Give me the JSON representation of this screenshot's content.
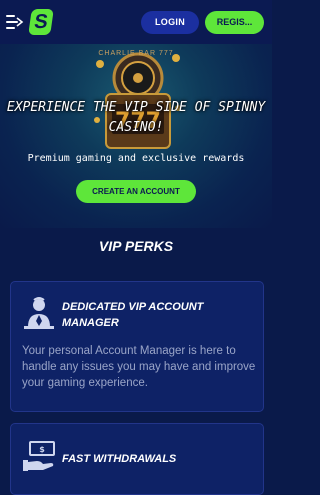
{
  "header": {
    "login_label": "LOGIN",
    "register_label": "REGIS...",
    "logo_text": "S"
  },
  "hero": {
    "banner_text": "CHARLIE BAR 777",
    "title": "EXPERIENCE THE VIP SIDE OF SPINNY CASINO!",
    "subtitle": "Premium gaming and exclusive rewards",
    "cta_label": "CREATE AN ACCOUNT"
  },
  "perks": {
    "title": "VIP PERKS",
    "items": [
      {
        "title": "DEDICATED VIP ACCOUNT MANAGER",
        "text": "Your personal Account Manager is here to handle any issues you may have and improve your gaming experience.",
        "icon": "account-manager-icon"
      },
      {
        "title": "FAST WITHDRAWALS",
        "text": "",
        "icon": "cash-hand-icon"
      }
    ]
  },
  "colors": {
    "accent": "#5ee63a",
    "header_bg": "#0b1a52",
    "login_bg": "#1b2fa0",
    "card_bg": "#0e2266",
    "page_bg": "#0a1a4a"
  }
}
